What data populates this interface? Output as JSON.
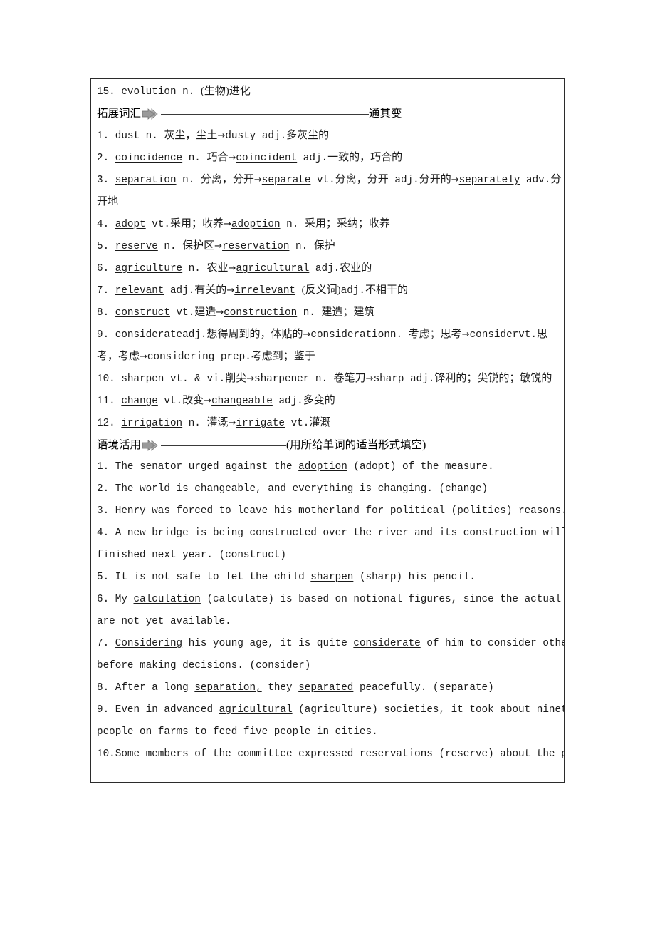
{
  "page": {
    "background_color": "#ffffff",
    "border_color": "#2b2b2b"
  },
  "top_entry": {
    "number": "15.",
    "word": "evolution",
    "pos": "n.",
    "definition": "(生物)进化"
  },
  "sections": [
    {
      "id": "extended-vocabulary",
      "label": "拓展词汇",
      "icon": "right-arrow-icon",
      "tail": "通其变",
      "rule_width": 292
    },
    {
      "id": "contextual-usage",
      "label": "语境活用",
      "icon": "right-arrow-icon",
      "tail": "(用所给单词的适当形式填空)",
      "rule_width": 176
    }
  ],
  "extended_vocabulary": {
    "items": [
      {
        "number": "1.",
        "segments": [
          {
            "t": "dust",
            "u": true,
            "k": "en"
          },
          {
            "t": " n. ",
            "k": "en"
          },
          {
            "t": "灰尘，",
            "k": "cjk"
          },
          {
            "t": "尘土",
            "u": true,
            "k": "cjk"
          },
          {
            "t": "→",
            "k": "ar"
          },
          {
            "t": "dusty",
            "u": true,
            "k": "en"
          },
          {
            "t": " adj.",
            "k": "en"
          },
          {
            "t": "多灰尘的",
            "k": "cjk"
          }
        ]
      },
      {
        "number": "2.",
        "segments": [
          {
            "t": "coincidence",
            "u": true,
            "k": "en"
          },
          {
            "t": " n. ",
            "k": "en"
          },
          {
            "t": "巧合",
            "k": "cjk"
          },
          {
            "t": "→",
            "k": "ar"
          },
          {
            "t": "coincident",
            "u": true,
            "k": "en"
          },
          {
            "t": " adj.",
            "k": "en"
          },
          {
            "t": "一致的，巧合的",
            "k": "cjk"
          }
        ]
      },
      {
        "number": "3.",
        "segments": [
          {
            "t": "separation",
            "u": true,
            "k": "en"
          },
          {
            "t": " n. ",
            "k": "en"
          },
          {
            "t": "分离，分开",
            "k": "cjk"
          },
          {
            "t": "→",
            "k": "ar"
          },
          {
            "t": "separate",
            "u": true,
            "k": "en"
          },
          {
            "t": " vt.",
            "k": "en"
          },
          {
            "t": "分离，分开",
            "k": "cjk"
          },
          {
            "t": " adj.",
            "k": "en"
          },
          {
            "t": "分开的",
            "k": "cjk"
          },
          {
            "t": "→",
            "k": "ar"
          },
          {
            "t": "separately",
            "u": true,
            "k": "en"
          },
          {
            "t": " adv.",
            "k": "en"
          },
          {
            "t": "分",
            "k": "cjk"
          }
        ]
      },
      {
        "number": "",
        "continuation": true,
        "segments": [
          {
            "t": "开地",
            "k": "cjk"
          }
        ]
      },
      {
        "number": "4.",
        "segments": [
          {
            "t": "adopt",
            "u": true,
            "k": "en"
          },
          {
            "t": " vt.",
            "k": "en"
          },
          {
            "t": "采用；收养",
            "k": "cjk"
          },
          {
            "t": "→",
            "k": "ar"
          },
          {
            "t": "adoption",
            "u": true,
            "k": "en"
          },
          {
            "t": " n. ",
            "k": "en"
          },
          {
            "t": "采用；采纳；收养",
            "k": "cjk"
          }
        ]
      },
      {
        "number": "5.",
        "segments": [
          {
            "t": "reserve",
            "u": true,
            "k": "en"
          },
          {
            "t": " n. ",
            "k": "en"
          },
          {
            "t": "保护区",
            "k": "cjk"
          },
          {
            "t": "→",
            "k": "ar"
          },
          {
            "t": "reservation",
            "u": true,
            "k": "en"
          },
          {
            "t": " n. ",
            "k": "en"
          },
          {
            "t": "保护",
            "k": "cjk"
          }
        ]
      },
      {
        "number": "6.",
        "segments": [
          {
            "t": "agriculture",
            "u": true,
            "k": "en"
          },
          {
            "t": " n. ",
            "k": "en"
          },
          {
            "t": "农业",
            "k": "cjk"
          },
          {
            "t": "→",
            "k": "ar"
          },
          {
            "t": "agricultural",
            "u": true,
            "k": "en"
          },
          {
            "t": " adj.",
            "k": "en"
          },
          {
            "t": "农业的",
            "k": "cjk"
          }
        ]
      },
      {
        "number": "7.",
        "segments": [
          {
            "t": "relevant",
            "u": true,
            "k": "en"
          },
          {
            "t": " adj.",
            "k": "en"
          },
          {
            "t": "有关的",
            "k": "cjk"
          },
          {
            "t": "→",
            "k": "ar"
          },
          {
            "t": "irrelevant",
            "u": true,
            "k": "en"
          },
          {
            "t": " ",
            "k": "en"
          },
          {
            "t": "(反义词)",
            "k": "cjk"
          },
          {
            "t": "adj.",
            "k": "en"
          },
          {
            "t": "不相干的",
            "k": "cjk"
          }
        ]
      },
      {
        "number": "8.",
        "segments": [
          {
            "t": "construct",
            "u": true,
            "k": "en"
          },
          {
            "t": " vt.",
            "k": "en"
          },
          {
            "t": "建造",
            "k": "cjk"
          },
          {
            "t": "→",
            "k": "ar"
          },
          {
            "t": "construction",
            "u": true,
            "k": "en"
          },
          {
            "t": " n. ",
            "k": "en"
          },
          {
            "t": "建造；建筑",
            "k": "cjk"
          }
        ]
      },
      {
        "number": "9.",
        "segments": [
          {
            "t": "considerate",
            "u": true,
            "k": "en"
          },
          {
            "t": "adj.",
            "k": "en"
          },
          {
            "t": "想得周到的，体贴的",
            "k": "cjk"
          },
          {
            "t": "→",
            "k": "ar"
          },
          {
            "t": "consideration",
            "u": true,
            "k": "en"
          },
          {
            "t": "n. ",
            "k": "en"
          },
          {
            "t": "考虑；思考",
            "k": "cjk"
          },
          {
            "t": "→",
            "k": "ar"
          },
          {
            "t": "consider",
            "u": true,
            "k": "en"
          },
          {
            "t": "vt.",
            "k": "en"
          },
          {
            "t": "思",
            "k": "cjk"
          }
        ]
      },
      {
        "number": "",
        "continuation": true,
        "segments": [
          {
            "t": "考，考虑",
            "k": "cjk"
          },
          {
            "t": "→",
            "k": "ar"
          },
          {
            "t": "considering",
            "u": true,
            "k": "en"
          },
          {
            "t": " prep.",
            "k": "en"
          },
          {
            "t": "考虑到；鉴于",
            "k": "cjk"
          }
        ]
      },
      {
        "number": "10.",
        "segments": [
          {
            "t": "sharpen",
            "u": true,
            "k": "en"
          },
          {
            "t": " vt. & vi.",
            "k": "en"
          },
          {
            "t": "削尖",
            "k": "cjk"
          },
          {
            "t": "→",
            "k": "ar"
          },
          {
            "t": "sharpener",
            "u": true,
            "k": "en"
          },
          {
            "t": " n. ",
            "k": "en"
          },
          {
            "t": "卷笔刀",
            "k": "cjk"
          },
          {
            "t": "→",
            "k": "ar"
          },
          {
            "t": "sharp",
            "u": true,
            "k": "en"
          },
          {
            "t": " adj.",
            "k": "en"
          },
          {
            "t": "锋利的；尖锐的；敏锐的",
            "k": "cjk"
          }
        ]
      },
      {
        "number": "11.",
        "segments": [
          {
            "t": "change",
            "u": true,
            "k": "en"
          },
          {
            "t": " vt.",
            "k": "en"
          },
          {
            "t": "改变",
            "k": "cjk"
          },
          {
            "t": "→",
            "k": "ar"
          },
          {
            "t": "changeable",
            "u": true,
            "k": "en"
          },
          {
            "t": " adj.",
            "k": "en"
          },
          {
            "t": "多变的",
            "k": "cjk"
          }
        ]
      },
      {
        "number": "12.",
        "segments": [
          {
            "t": "irrigation",
            "u": true,
            "k": "en"
          },
          {
            "t": " n. ",
            "k": "en"
          },
          {
            "t": "灌溉",
            "k": "cjk"
          },
          {
            "t": "→",
            "k": "ar"
          },
          {
            "t": "irrigate",
            "u": true,
            "k": "en"
          },
          {
            "t": " vt.",
            "k": "en"
          },
          {
            "t": "灌溉",
            "k": "cjk"
          }
        ]
      }
    ]
  },
  "contextual_usage": {
    "items": [
      {
        "number": "1.",
        "segments": [
          {
            "t": "The senator urged against the ",
            "k": "en"
          },
          {
            "t": "adoption",
            "u": true,
            "k": "en"
          },
          {
            "t": " (adopt) of the measure.",
            "k": "en"
          }
        ]
      },
      {
        "number": "2.",
        "segments": [
          {
            "t": "The world is ",
            "k": "en"
          },
          {
            "t": "changeable,",
            "u": true,
            "k": "en"
          },
          {
            "t": " and everything is ",
            "k": "en"
          },
          {
            "t": "changing",
            "u": true,
            "k": "en"
          },
          {
            "t": ". (change)",
            "k": "en"
          }
        ]
      },
      {
        "number": "3.",
        "segments": [
          {
            "t": "Henry was forced to leave his motherland for ",
            "k": "en"
          },
          {
            "t": "political",
            "u": true,
            "k": "en"
          },
          {
            "t": " (politics) reasons.",
            "k": "en"
          }
        ]
      },
      {
        "number": "4.",
        "segments": [
          {
            "t": "A new bridge is being ",
            "k": "en"
          },
          {
            "t": "constructed",
            "u": true,
            "k": "en"
          },
          {
            "t": " over the river and its ",
            "k": "en"
          },
          {
            "t": "construction",
            "u": true,
            "k": "en"
          },
          {
            "t": " will be",
            "k": "en"
          }
        ]
      },
      {
        "number": "",
        "continuation": true,
        "segments": [
          {
            "t": "finished next year. (construct)",
            "k": "en"
          }
        ]
      },
      {
        "number": "5.",
        "segments": [
          {
            "t": "It is not safe to let the child ",
            "k": "en"
          },
          {
            "t": "sharpen",
            "u": true,
            "k": "en"
          },
          {
            "t": " (sharp) his pencil.",
            "k": "en"
          }
        ]
      },
      {
        "number": "6.",
        "segments": [
          {
            "t": "My ",
            "k": "en"
          },
          {
            "t": "calculation",
            "u": true,
            "k": "en"
          },
          {
            "t": " (calculate) is based on notional figures, since the actual figu",
            "k": "en"
          }
        ]
      },
      {
        "number": "",
        "continuation": true,
        "segments": [
          {
            "t": "are not yet available.",
            "k": "en"
          }
        ]
      },
      {
        "number": "7.",
        "segments": [
          {
            "t": "Considering",
            "u": true,
            "k": "en"
          },
          {
            "t": " his young age, it is quite ",
            "k": "en"
          },
          {
            "t": "considerate",
            "u": true,
            "k": "en"
          },
          {
            "t": " of him to consider other pe",
            "k": "en"
          }
        ]
      },
      {
        "number": "",
        "continuation": true,
        "segments": [
          {
            "t": "before making decisions. (consider)",
            "k": "en"
          }
        ]
      },
      {
        "number": "8.",
        "segments": [
          {
            "t": "After a long ",
            "k": "en"
          },
          {
            "t": "separation,",
            "u": true,
            "k": "en"
          },
          {
            "t": " they ",
            "k": "en"
          },
          {
            "t": "separated",
            "u": true,
            "k": "en"
          },
          {
            "t": " peacefully. (separate)",
            "k": "en"
          }
        ]
      },
      {
        "number": "9.",
        "segments": [
          {
            "t": "Even in advanced ",
            "k": "en"
          },
          {
            "t": "agricultural",
            "u": true,
            "k": "en"
          },
          {
            "t": " (agriculture) societies, it took about ninety-fi",
            "k": "en"
          }
        ]
      },
      {
        "number": "",
        "continuation": true,
        "segments": [
          {
            "t": "people on farms to feed five people in cities.",
            "k": "en"
          }
        ]
      },
      {
        "number": "10.",
        "nospace": true,
        "segments": [
          {
            "t": "Some members of the committee expressed ",
            "k": "en"
          },
          {
            "t": "reservations",
            "u": true,
            "k": "en"
          },
          {
            "t": " (reserve) about the propo",
            "k": "en"
          }
        ]
      }
    ]
  }
}
